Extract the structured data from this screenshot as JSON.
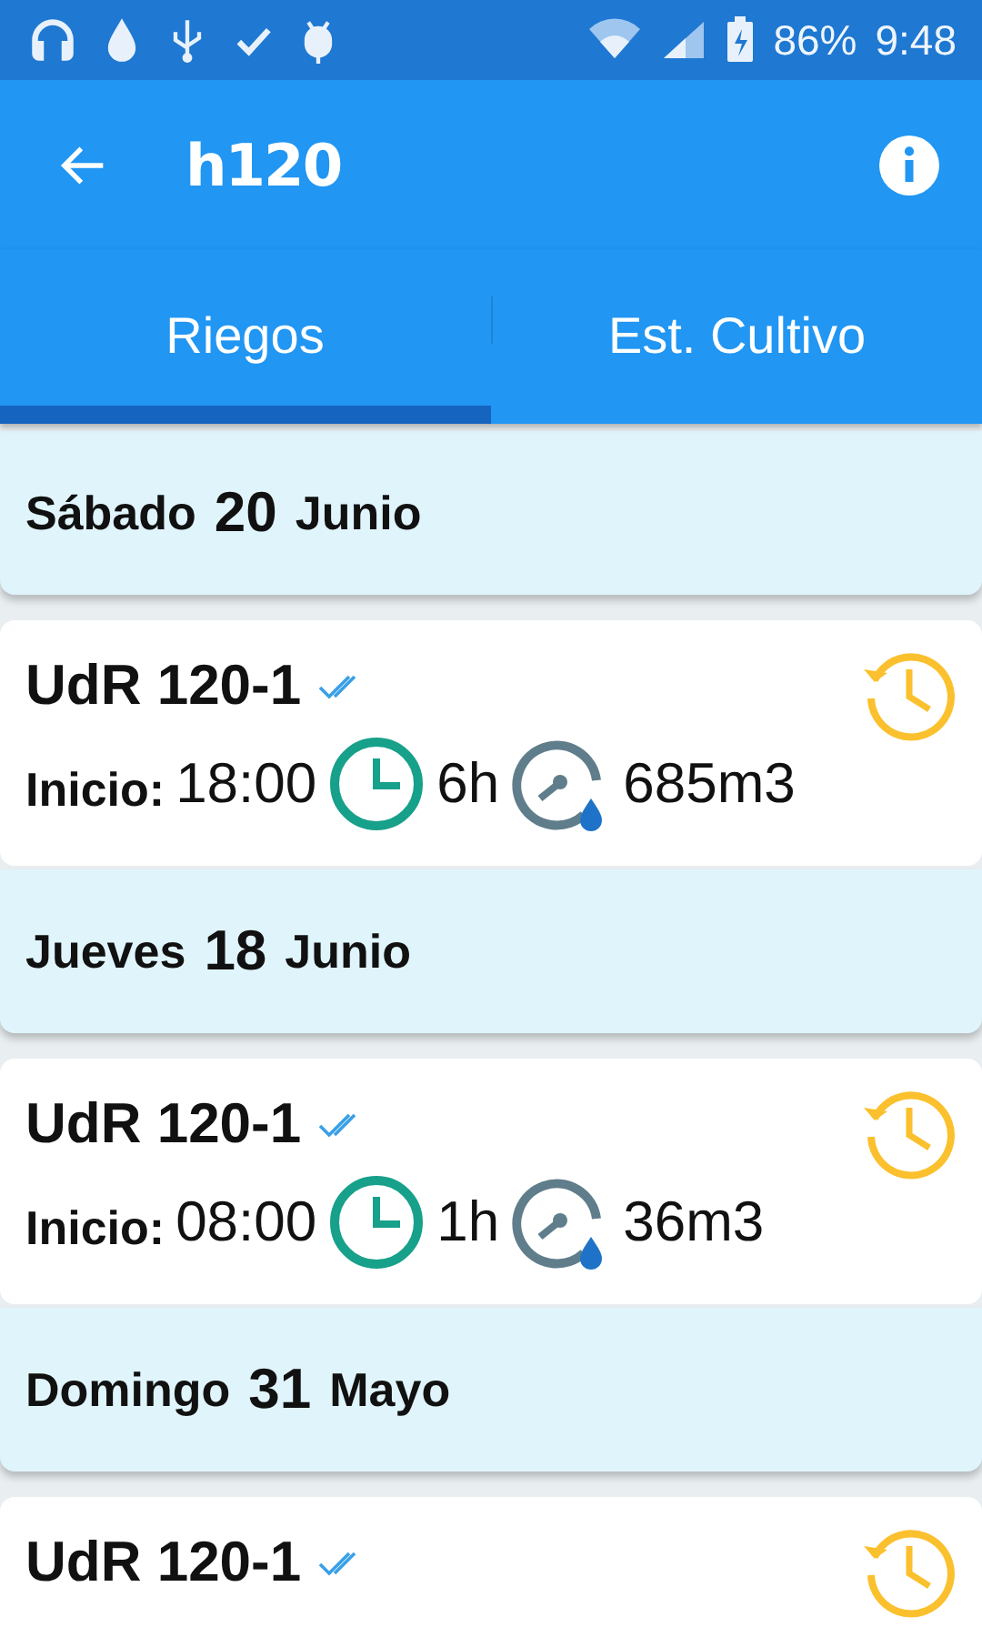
{
  "status_bar": {
    "battery": "86%",
    "time": "9:48"
  },
  "app_bar": {
    "logo": "h120"
  },
  "tabs": [
    {
      "label": "Riegos",
      "selected": true
    },
    {
      "label": "Est. Cultivo",
      "selected": false
    }
  ],
  "days": [
    {
      "weekday": "Sábado",
      "day": "20",
      "month": "Junio",
      "entries": [
        {
          "name": "UdR 120-1",
          "start_label": "Inicio:",
          "start": "18:00",
          "duration": "6h",
          "volume": "685m3"
        }
      ]
    },
    {
      "weekday": "Jueves",
      "day": "18",
      "month": "Junio",
      "entries": [
        {
          "name": "UdR 120-1",
          "start_label": "Inicio:",
          "start": "08:00",
          "duration": "1h",
          "volume": "36m3"
        }
      ]
    },
    {
      "weekday": "Domingo",
      "day": "31",
      "month": "Mayo",
      "entries": [
        {
          "name": "UdR 120-1"
        }
      ]
    }
  ]
}
